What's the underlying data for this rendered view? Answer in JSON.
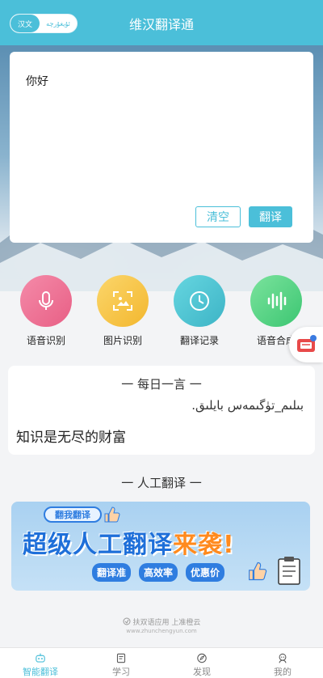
{
  "header": {
    "title": "维汉翻译通",
    "lang_active": "汉文",
    "lang_other": "ئۇيغۇرچە"
  },
  "translator": {
    "input_text": "你好",
    "clear_label": "清空",
    "translate_label": "翻译"
  },
  "features": [
    {
      "label": "语音识别",
      "icon": "microphone-icon"
    },
    {
      "label": "图片识别",
      "icon": "image-scan-icon"
    },
    {
      "label": "翻译记录",
      "icon": "clock-icon"
    },
    {
      "label": "语音合成",
      "icon": "sound-wave-icon"
    }
  ],
  "daily_quote": {
    "heading": "一 每日一言 一",
    "uyghur": "بىلىم_تۈگىمەس بايلىق.",
    "chinese": "知识是无尽的财富"
  },
  "human_translation": {
    "section_title": "一 人工翻译 一",
    "banner": {
      "tag": "翻我翻译",
      "headline_main": "超级人工翻译",
      "headline_highlight": "来袭!",
      "pills": [
        "翻译准",
        "高效率",
        "优惠价"
      ]
    }
  },
  "footer": {
    "brand": "扶双语应用 上准橙云",
    "url": "www.zhunchengyun.com"
  },
  "tabbar": [
    {
      "label": "智能翻译",
      "icon": "robot-icon",
      "active": true
    },
    {
      "label": "学习",
      "icon": "notes-icon",
      "active": false
    },
    {
      "label": "发现",
      "icon": "compass-icon",
      "active": false
    },
    {
      "label": "我的",
      "icon": "profile-icon",
      "active": false
    }
  ],
  "colors": {
    "accent": "#4bbfd9",
    "voice": "#ee7096",
    "image": "#f6c445",
    "history": "#4cc3d2",
    "synth": "#52d082"
  }
}
